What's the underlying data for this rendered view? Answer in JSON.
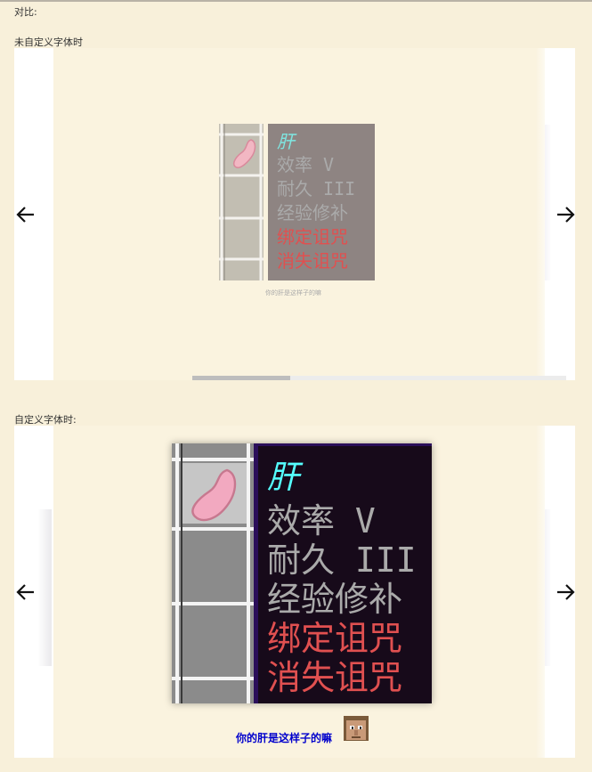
{
  "sections": {
    "compare_label": "对比:",
    "default_label": "未自定义字体时",
    "custom_label": "自定义字体时:"
  },
  "item_tooltip": {
    "name": "肝",
    "lines": [
      {
        "text": "效率 V",
        "color": "#aaaaaa"
      },
      {
        "text": "耐久 III",
        "color": "#aaaaaa"
      },
      {
        "text": "经验修补",
        "color": "#aaaaaa"
      },
      {
        "text": "绑定诅咒",
        "color": "#e05050"
      },
      {
        "text": "消失诅咒",
        "color": "#e05050"
      }
    ],
    "name_color": "#55ffff"
  },
  "captions": {
    "small": "你的肝是这样子的嘛",
    "big": "你的肝是这样子的嘛"
  },
  "icons": {
    "prev": "arrow-left-icon",
    "next": "arrow-right-icon",
    "item": "liver-item-icon",
    "emoji": "villager-face-icon"
  }
}
